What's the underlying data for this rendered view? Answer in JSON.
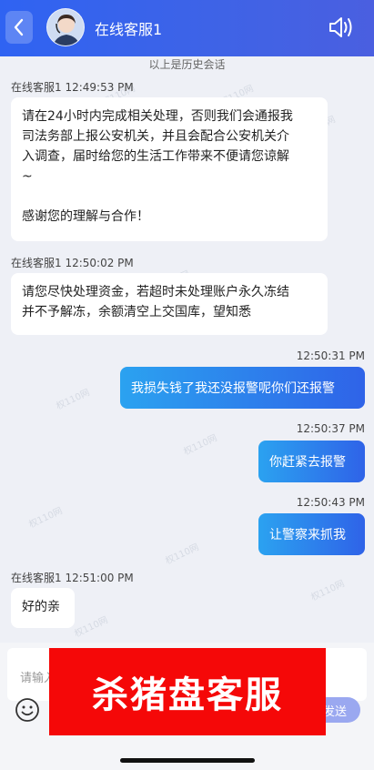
{
  "header": {
    "title": "在线客服1"
  },
  "history_label": "以上是历史会话",
  "watermark_text": "权110网",
  "messages": [
    {
      "side": "left",
      "meta": "在线客服1 12:49:53 PM",
      "lines": [
        "请在24小时内完成相关处理，否则我们会通报我",
        "司法务部上报公安机关，并且会配合公安机关介",
        "入调查，届时给您的生活工作带来不便请您谅解",
        "~",
        "",
        "感谢您的理解与合作！"
      ]
    },
    {
      "side": "left",
      "meta": "在线客服1 12:50:02 PM",
      "lines": [
        "请您尽快处理资金，若超时未处理账户永久冻结",
        "并不予解冻，余额清空上交国库，望知悉"
      ]
    },
    {
      "side": "right",
      "time": "12:50:31 PM",
      "text": "我损失钱了我还没报警呢你们还报警"
    },
    {
      "side": "right",
      "time": "12:50:37 PM",
      "text": "你赶紧去报警"
    },
    {
      "side": "right",
      "time": "12:50:43 PM",
      "text": "让警察来抓我"
    },
    {
      "side": "left",
      "meta": "在线客服1 12:51:00 PM",
      "lines": [
        "好的亲"
      ]
    }
  ],
  "input": {
    "placeholder": "请输入",
    "send_label": "发送"
  },
  "banner_text": "杀猪盘客服",
  "colors": {
    "header": "#3562ee",
    "banner": "#f50808",
    "bubble_right_start": "#2ba2f0",
    "bubble_right_end": "#2f63e8"
  }
}
